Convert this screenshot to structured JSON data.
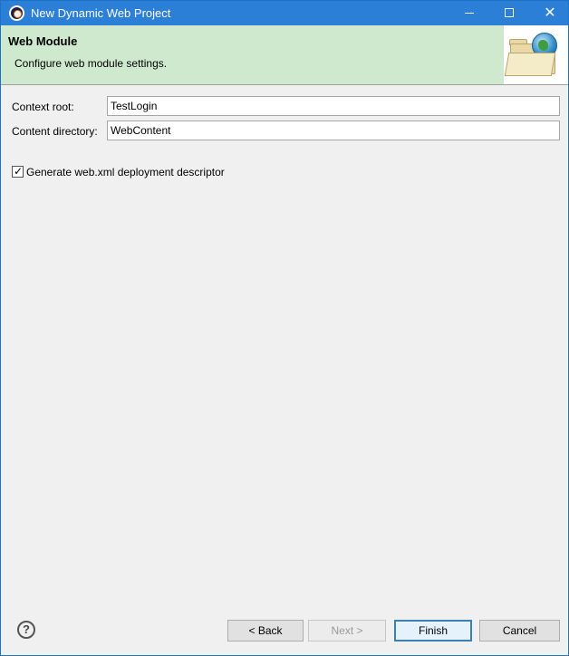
{
  "window": {
    "title": "New Dynamic Web Project",
    "controls": {
      "minimize_icon": "minimize-icon",
      "maximize_icon": "maximize-icon",
      "close_icon": "close-icon",
      "close_glyph": "✕"
    }
  },
  "banner": {
    "title": "Web Module",
    "description": "Configure web module settings.",
    "image_icon": "web-module-wizard-icon",
    "bg_color": "#cfe9cf"
  },
  "form": {
    "context_root": {
      "label": "Context root:",
      "value": "TestLogin"
    },
    "content_directory": {
      "label": "Content directory:",
      "value": "WebContent"
    },
    "generate_web_xml": {
      "label": "Generate web.xml deployment descriptor",
      "checked": true,
      "glyph": "✓"
    }
  },
  "footer": {
    "help_glyph": "?",
    "back_label": "< Back",
    "next_label": "Next >",
    "next_enabled": false,
    "finish_label": "Finish",
    "cancel_label": "Cancel"
  },
  "colors": {
    "titlebar": "#2b7fd6",
    "accent_border": "#3c7fb1"
  }
}
